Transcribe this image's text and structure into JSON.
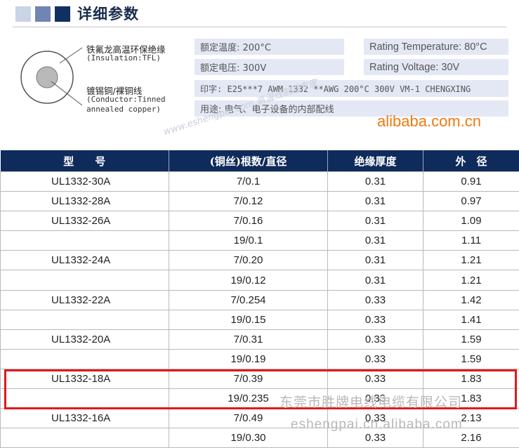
{
  "header": {
    "title": "详细参数"
  },
  "diagram": {
    "insulation_label": "铁氟龙高温环保绝缘",
    "insulation_sub": "(Insulation:TFL)",
    "conductor_label": "镀锡铜/裸铜线",
    "conductor_sub1": "(Conductor:Tinned",
    "conductor_sub2": "annealed copper)"
  },
  "specs": {
    "temp_cn": "额定温度: 200°C",
    "temp_en": "Rating Temperature: 80°C",
    "volt_cn": "额定电压: 300V",
    "volt_en": "Rating Voltage: 30V",
    "marking": "印字: E25***7  AWM 1332 **AWG 200°C 300V VM-1 CHENGXING",
    "usage": "用途: 电气、电子设备的内部配线"
  },
  "brand": "alibaba.com.cn",
  "watermark_diag": "www.eshengpai.com  高温线制造专家",
  "table": {
    "headers": [
      "型　　号",
      "(铜丝)根数/直径",
      "绝缘厚度",
      "外　径"
    ],
    "rows": [
      [
        "UL1332-30A",
        "7/0.1",
        "0.31",
        "0.91"
      ],
      [
        "UL1332-28A",
        "7/0.12",
        "0.31",
        "0.97"
      ],
      [
        "UL1332-26A",
        "7/0.16",
        "0.31",
        "1.09"
      ],
      [
        "",
        "19/0.1",
        "0.31",
        "1.11"
      ],
      [
        "UL1332-24A",
        "7/0.20",
        "0.31",
        "1.21"
      ],
      [
        "",
        "19/0.12",
        "0.31",
        "1.21"
      ],
      [
        "UL1332-22A",
        "7/0.254",
        "0.33",
        "1.42"
      ],
      [
        "",
        "19/0.15",
        "0.33",
        "1.41"
      ],
      [
        "UL1332-20A",
        "7/0.31",
        "0.33",
        "1.59"
      ],
      [
        "",
        "19/0.19",
        "0.33",
        "1.59"
      ],
      [
        "UL1332-18A",
        "7/0.39",
        "0.33",
        "1.83"
      ],
      [
        "",
        "19/0.235",
        "0.33",
        "1.83"
      ],
      [
        "UL1332-16A",
        "7/0.49",
        "0.33",
        "2.13"
      ],
      [
        "",
        "19/0.30",
        "0.33",
        "2.16"
      ]
    ]
  },
  "watermark_company": "东莞市胜牌电线电缆有限公司",
  "watermark_url": "eshengpai.cn.alibaba.com",
  "colors": {
    "header_bg": "#0f2b5b",
    "spec_box": "#e4e8f5",
    "highlight": "#e0191d",
    "brand": "#f07a10"
  }
}
